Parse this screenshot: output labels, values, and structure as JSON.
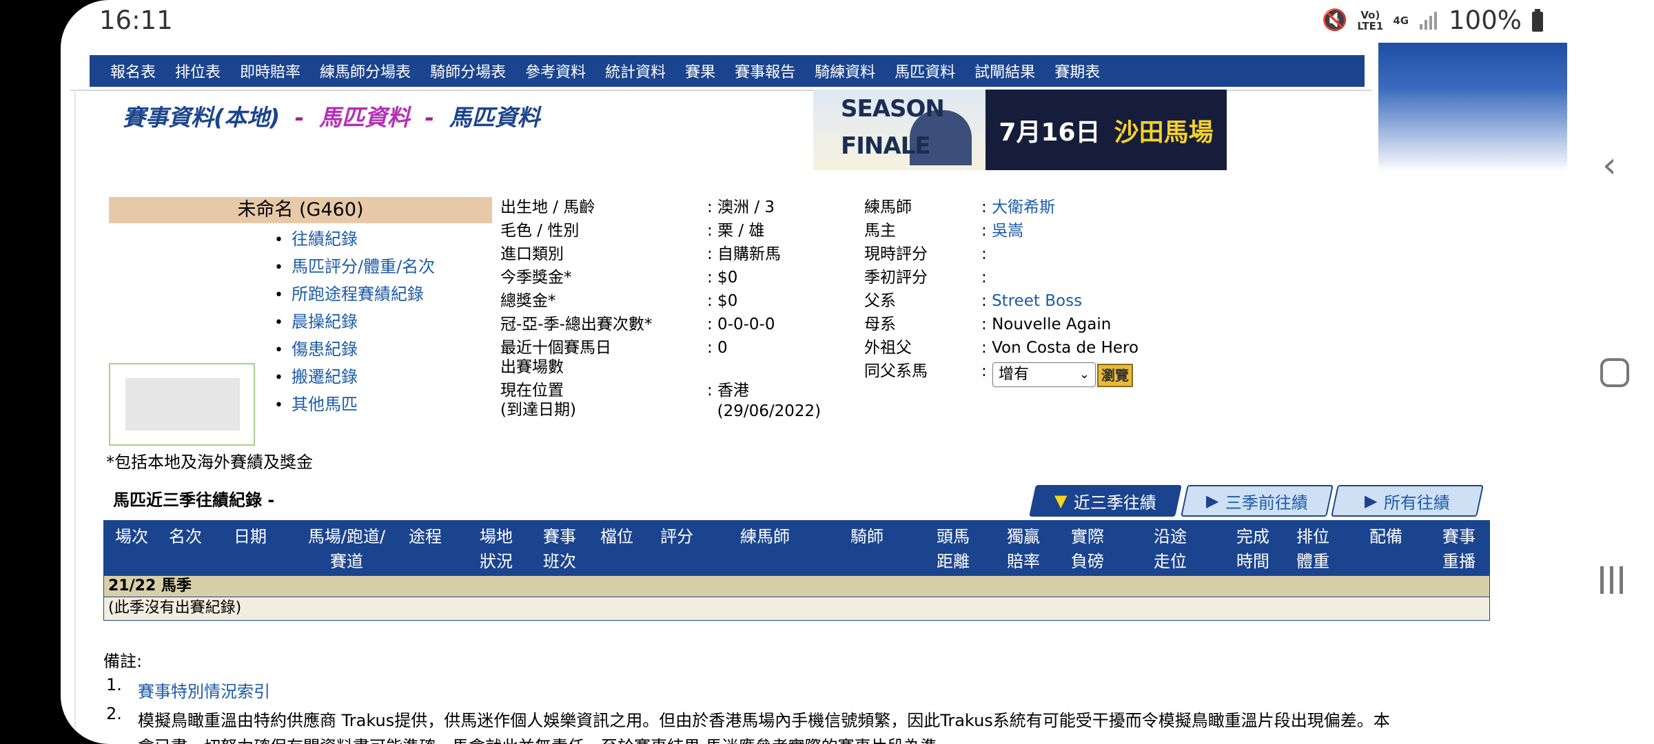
{
  "status_bar": {
    "time": "16:11",
    "signal_top": "Vo)",
    "signal_mid": "LTE1",
    "network": "4G",
    "battery": "100%"
  },
  "menu": [
    "報名表",
    "排位表",
    "即時賠率",
    "練馬師分場表",
    "騎師分場表",
    "參考資料",
    "統計資料",
    "賽果",
    "賽事報告",
    "騎練資料",
    "馬匹資料",
    "試閘結果",
    "賽期表"
  ],
  "heading": {
    "part1": "賽事資料(本地)",
    "sep1": "-",
    "part2": "馬匹資料",
    "sep2": "-",
    "part3": "馬匹資料"
  },
  "banner": {
    "line1": "SEASON",
    "line2": "FINALE",
    "date": "7月16日",
    "venue": "沙田馬場"
  },
  "horse": {
    "name": "未命名 (G460)"
  },
  "horse_links": [
    "往績紀錄",
    "馬匹評分/體重/名次",
    "所跑途程賽績紀錄",
    "晨操紀錄",
    "傷患紀錄",
    "搬遷紀錄",
    "其他馬匹"
  ],
  "info_left": [
    {
      "label": "出生地 / 馬齡",
      "value": ": 澳洲 / 3"
    },
    {
      "label": "毛色 / 性別",
      "value": ": 栗 / 雄"
    },
    {
      "label": "進口類別",
      "value": ": 自購新馬"
    },
    {
      "label": "今季獎金*",
      "value": ": $0"
    },
    {
      "label": "總獎金*",
      "value": ": $0"
    },
    {
      "label": "冠-亞-季-總出賽次數*",
      "value": ": 0-0-0-0"
    },
    {
      "label": "最近十個賽馬日",
      "value": ": 0"
    },
    {
      "label": "出賽場數",
      "value": ""
    },
    {
      "label": "現在位置",
      "value": ": 香港"
    },
    {
      "label": "(到達日期)",
      "value": "  (29/06/2022)"
    }
  ],
  "info_right": {
    "trainer_label": "練馬師",
    "trainer": "大衛希斯",
    "owner_label": "馬主",
    "owner": "吳嵩",
    "current_rating_label": "現時評分",
    "season_start_rating_label": "季初評分",
    "sire_label": "父系",
    "sire": "Street Boss",
    "dam_label": "母系",
    "dam": "Nouvelle Again",
    "damsire_label": "外祖父",
    "damsire": "Von Costa de Hero",
    "same_sire_label": "同父系馬",
    "colon": ":",
    "select_value": "增有",
    "browse_label": "瀏覽"
  },
  "footnote": "*包括本地及海外賽績及獎金",
  "section_title": "馬匹近三季往績紀錄 -",
  "tabs": [
    "近三季往績",
    "三季前往績",
    "所有往績"
  ],
  "table_headers": [
    [
      "場次",
      ""
    ],
    [
      "名次",
      ""
    ],
    [
      "日期",
      ""
    ],
    [
      "馬場/跑道/",
      "賽道"
    ],
    [
      "途程",
      ""
    ],
    [
      "場地",
      "狀況"
    ],
    [
      "賽事",
      "班次"
    ],
    [
      "檔位",
      ""
    ],
    [
      "評分",
      ""
    ],
    [
      "練馬師",
      ""
    ],
    [
      "騎師",
      ""
    ],
    [
      "頭馬",
      "距離"
    ],
    [
      "獨贏",
      "賠率"
    ],
    [
      "實際",
      "負磅"
    ],
    [
      "沿途",
      "走位"
    ],
    [
      "完成",
      "時間"
    ],
    [
      "排位",
      "體重"
    ],
    [
      "配備",
      ""
    ],
    [
      "賽事",
      "重播"
    ]
  ],
  "season_row": "21/22 馬季",
  "empty_row": "(此季沒有出賽紀錄)",
  "remarks": {
    "label": "備註:",
    "items": [
      {
        "num": "1.",
        "text": "賽事特別情況索引"
      },
      {
        "num": "2.",
        "text": "模擬鳥瞰重溫由特約供應商 Trakus提供，供馬迷作個人娛樂資訊之用。但由於香港馬場內手機信號頻繁，因此Trakus系統有可能受干擾而令模擬鳥瞰重溫片段出現偏差。本"
      },
      {
        "num": "",
        "text": "會已盡一切努力確保有關資料盡可能準確，馬會就此並無責任。至於賽事結果,馬迷應參考實際的賽事片段為準。"
      }
    ]
  }
}
